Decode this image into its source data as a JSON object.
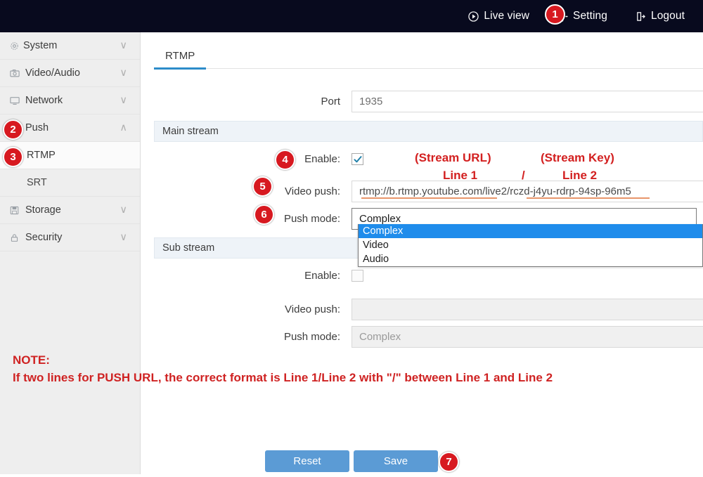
{
  "topbar": {
    "items": [
      {
        "label": "Live view",
        "icon": "play-circle-icon"
      },
      {
        "label": "Setting",
        "icon": "gear-icon"
      },
      {
        "label": "Logout",
        "icon": "logout-icon"
      }
    ]
  },
  "sidebar": {
    "items": [
      {
        "label": "System",
        "icon": "gear-icon",
        "chevron": "∨",
        "sub": false,
        "selected": false
      },
      {
        "label": "Video/Audio",
        "icon": "camera-icon",
        "chevron": "∨",
        "sub": false,
        "selected": false
      },
      {
        "label": "Network",
        "icon": "monitor-icon",
        "chevron": "∨",
        "sub": false,
        "selected": false
      },
      {
        "label": "Push",
        "icon": "cloud-upload-icon",
        "chevron": "∧",
        "sub": false,
        "selected": false
      },
      {
        "label": "RTMP",
        "icon": "",
        "chevron": "",
        "sub": true,
        "selected": true
      },
      {
        "label": "SRT",
        "icon": "",
        "chevron": "",
        "sub": true,
        "selected": false
      },
      {
        "label": "Storage",
        "icon": "save-icon",
        "chevron": "∨",
        "sub": false,
        "selected": false
      },
      {
        "label": "Security",
        "icon": "lock-icon",
        "chevron": "∨",
        "sub": false,
        "selected": false
      }
    ]
  },
  "main": {
    "tab": "RTMP",
    "port": {
      "label": "Port",
      "value": "1935"
    },
    "main_stream": {
      "title": "Main stream",
      "enable": {
        "label": "Enable:",
        "checked": true
      },
      "video_push": {
        "label": "Video push:",
        "value": "rtmp://b.rtmp.youtube.com/live2/rczd-j4yu-rdrp-94sp-96m5"
      },
      "push_mode": {
        "label": "Push mode:",
        "value": "Complex"
      }
    },
    "dropdown": {
      "open": true,
      "options": [
        "Complex",
        "Video",
        "Audio"
      ],
      "selected": "Complex"
    },
    "sub_stream": {
      "title": "Sub stream",
      "enable": {
        "label": "Enable:",
        "checked": false
      },
      "video_push": {
        "label": "Video push:",
        "value": ""
      },
      "push_mode": {
        "label": "Push mode:",
        "value": "Complex"
      }
    },
    "buttons": {
      "reset": "Reset",
      "save": "Save"
    }
  },
  "annotations": {
    "stream_url_title": "(Stream URL)",
    "stream_url_line": "Line 1",
    "slash": "/",
    "stream_key_title": "(Stream Key)",
    "stream_key_line": "Line 2",
    "note_title": "NOTE:",
    "note_body": "If two lines for PUSH URL, the correct format is Line 1/Line 2 with \"/\" between Line 1 and Line 2",
    "badges": [
      "1",
      "2",
      "3",
      "4",
      "5",
      "6",
      "7"
    ]
  },
  "colors": {
    "topbar_bg": "#080a1e",
    "sidebar_bg": "#eeeeee",
    "accent_tab": "#2d8cc9",
    "badge_red": "#d71920",
    "annotation_red": "#cf2222",
    "button_blue": "#5b9bd5",
    "dropdown_highlight": "#1f8ceb",
    "underline_orange": "#e8956a"
  }
}
